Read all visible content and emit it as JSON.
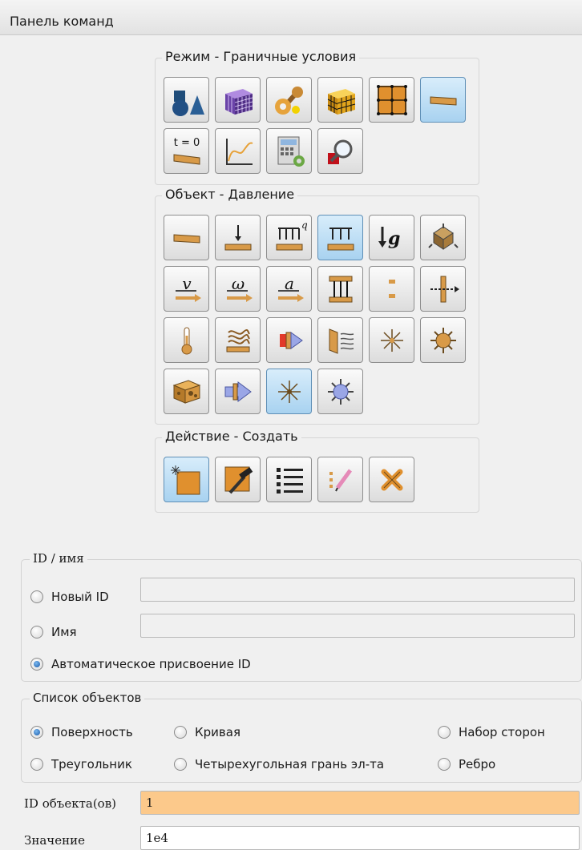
{
  "title": "Панель команд",
  "groups": {
    "mode": {
      "label": "Режим - Граничные условия"
    },
    "object": {
      "label": "Объект - Давление"
    },
    "action": {
      "label": "Действие - Создать"
    }
  },
  "mode_icons": [
    "geometry-icon",
    "mesh-icon",
    "tools-icon",
    "volume-mesh-icon",
    "grid-icon",
    "boundary-conditions-icon",
    "initial-conditions-icon",
    "curve-plot-icon",
    "calculator-icon",
    "search-icon"
  ],
  "initial_label": "t = 0",
  "object_icons": [
    "pressure-icon",
    "point-force-icon",
    "distributed-load-icon",
    "surface-pressure-icon",
    "gravity-icon",
    "spring-icon",
    "velocity-icon",
    "angular-velocity-icon",
    "acceleration-icon",
    "pillar-icon",
    "connector-icon",
    "cut-plane-icon",
    "temperature-icon",
    "heat-flux-icon",
    "convection-icon",
    "radiation-icon",
    "heat-source-icon",
    "point-source-icon",
    "cheese-icon",
    "flow-icon",
    "star-icon",
    "point-light-icon"
  ],
  "object_glyphs": {
    "gravity": "↓g",
    "velocity": "v",
    "angular_velocity": "ω",
    "acceleration": "a",
    "distributed_q": "q"
  },
  "action_icons": [
    "create-icon",
    "edit-icon",
    "list-icon",
    "modify-icon",
    "delete-icon"
  ],
  "id_name": {
    "label": "ID / имя",
    "new_id": "Новый ID",
    "name": "Имя",
    "auto": "Автоматическое присвоение ID",
    "new_id_value": "",
    "name_value": ""
  },
  "object_list": {
    "label": "Список объектов",
    "options": [
      "Поверхность",
      "Кривая",
      "Набор сторон",
      "Треугольник",
      "Четырехугольная грань эл-та",
      "Ребро"
    ],
    "selected": "Поверхность"
  },
  "fields": {
    "object_ids_label": "ID объекта(ов)",
    "object_ids_value": "1",
    "value_label": "Значение",
    "value_value": "1e4"
  }
}
